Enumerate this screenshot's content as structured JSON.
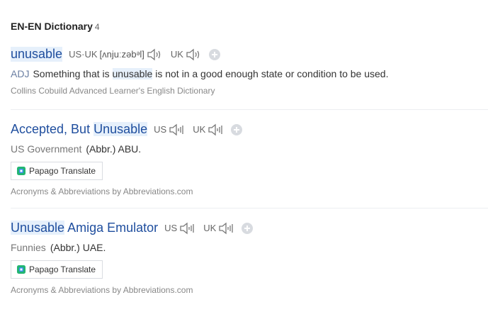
{
  "section": {
    "title": "EN-EN Dictionary",
    "count": "4"
  },
  "entries": [
    {
      "headword": "unusable",
      "pron_label": "US·UK",
      "ipa": "[ʌnjuːzəbᵊl]",
      "uk_label": "UK",
      "pos": "ADJ",
      "def_before": "Something that is",
      "def_highlight": "unusable",
      "def_after": "is not in a good enough state or condition to be used.",
      "source": "Collins Cobuild Advanced Learner's English Dictionary"
    },
    {
      "headword_before": "Accepted, But",
      "headword_highlight": "Unusable",
      "us_label": "US",
      "uk_label": "UK",
      "category": "US Government",
      "abbr": "(Abbr.) ABU.",
      "papago": "Papago Translate",
      "source": "Acronyms & Abbreviations by Abbreviations.com"
    },
    {
      "headword_highlight": "Unusable",
      "headword_after": "Amiga Emulator",
      "us_label": "US",
      "uk_label": "UK",
      "category": "Funnies",
      "abbr": "(Abbr.) UAE.",
      "papago": "Papago Translate",
      "source": "Acronyms & Abbreviations by Abbreviations.com"
    }
  ],
  "icons": {
    "speaker": "speaker-icon",
    "add": "plus-icon",
    "papago": "papago-icon"
  },
  "colors": {
    "headword": "#1f4e9e",
    "highlight": "#e6f0fb",
    "divider": "#eceef1"
  }
}
